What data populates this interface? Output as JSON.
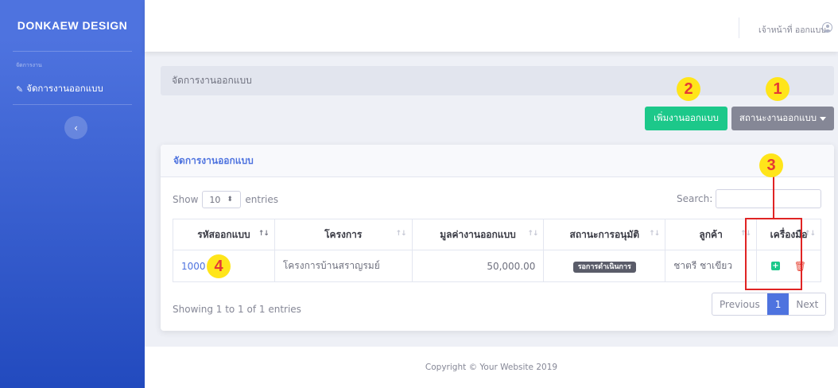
{
  "sidebar": {
    "brand": "DONKAEW DESIGN",
    "heading": "จัดการงาน",
    "items": [
      {
        "label": "จัดการงานออกแบบ",
        "icon": "pencil-icon"
      }
    ],
    "toggle_icon": "chevron-left-icon",
    "toggle_glyph": "‹"
  },
  "topbar": {
    "user_name": "เจ้าหน้าที่ ออกแบบ",
    "user_icon": "user-circle-icon"
  },
  "page": {
    "breadcrumb": "จัดการงานออกแบบ",
    "add_button": "เพิ่มงานออกแบบ",
    "status_button": "สถานะงานออกแบบ"
  },
  "callouts": [
    "1",
    "2",
    "3",
    "4"
  ],
  "card": {
    "title": "จัดการงานออกแบบ",
    "show_label": "Show",
    "entries_label": "entries",
    "page_length": "10",
    "search_label": "Search:",
    "search_value": "",
    "columns": [
      "รหัสออกแบบ",
      "โครงการ",
      "มูลค่างานออกแบบ",
      "สถานะการอนุมัติ",
      "ลูกค้า",
      "เครื่องมือ"
    ],
    "sort_glyph": "↑↓",
    "rows": [
      {
        "id": "1000",
        "project": "โครงการบ้านสราญรมย์",
        "value": "50,000.00",
        "status": "รอการดำเนินการ",
        "customer": "ชาตรี ชาเขียว",
        "actions": [
          "plus-square-icon",
          "trash-icon"
        ],
        "add_glyph": "+",
        "delete_glyph": "🗑"
      }
    ],
    "info": "Showing 1 to 1 of 1 entries",
    "pagination": {
      "previous": "Previous",
      "current": "1",
      "next": "Next"
    }
  },
  "footer": "Copyright © Your Website 2019",
  "colors": {
    "primary": "#4e73df",
    "success": "#1cc88a",
    "secondary": "#858796",
    "danger": "#e74a3b",
    "callout": "#ffe51a",
    "annotation": "#e02424"
  }
}
